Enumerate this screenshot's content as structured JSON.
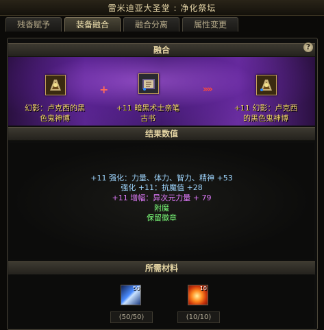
{
  "window": {
    "title": "雷米迪亚大圣堂 : 净化祭坛"
  },
  "tabs": [
    {
      "label": "残香赋予",
      "active": false
    },
    {
      "label": "装备融合",
      "active": true
    },
    {
      "label": "融合分离",
      "active": false
    },
    {
      "label": "属性变更",
      "active": false
    }
  ],
  "fusion": {
    "header": "融合",
    "help_label": "?",
    "operator_plus": "+",
    "operator_arrow": "»»",
    "items": [
      {
        "name_line1": "幻影：卢克西的黑",
        "name_line2": "色鬼神博",
        "icon": "armor-item-icon"
      },
      {
        "name_line1": "+11 暗黑术士亲笔",
        "name_line2": "古书",
        "icon": "book-item-icon"
      },
      {
        "name_line1": "+11 幻影：卢克西",
        "name_line2": "的黑色鬼神博",
        "icon": "armor-result-icon"
      }
    ]
  },
  "results": {
    "header": "结果数值",
    "lines": [
      {
        "text": "+11 强化：力量、体力、智力、精神 +53",
        "color": "#9fd6ff"
      },
      {
        "text": "强化 +11：抗魔值 +28",
        "color": "#9fd6ff"
      },
      {
        "text": "+11 增幅：异次元力量 + 79",
        "color": "#e37cff"
      },
      {
        "text": "附魔",
        "color": "#7cff7a"
      },
      {
        "text": "保留徽章",
        "color": "#7cff7a"
      }
    ]
  },
  "materials": {
    "header": "所需材料",
    "items": [
      {
        "icon": "crystal-material-icon",
        "count": "50",
        "progress": "(50/50)"
      },
      {
        "icon": "flame-material-icon",
        "count": "10",
        "progress": "(10/10)"
      }
    ]
  }
}
